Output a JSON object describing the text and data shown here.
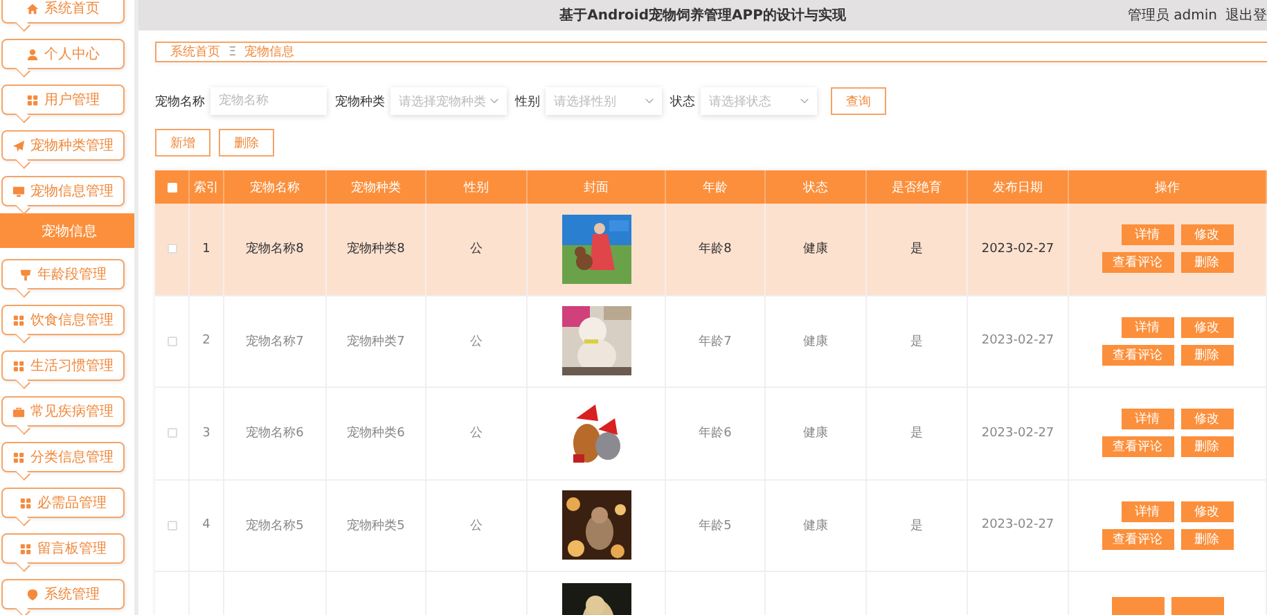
{
  "header": {
    "title": "基于Android宠物饲养管理APP的设计与实现",
    "user": "管理员 admin",
    "logout": "退出登"
  },
  "sidebar": {
    "items": [
      {
        "label": "系统首页",
        "selected": false
      },
      {
        "label": "个人中心",
        "selected": false
      },
      {
        "label": "用户管理",
        "selected": false
      },
      {
        "label": "宠物种类管理",
        "selected": false
      },
      {
        "label": "宠物信息管理",
        "selected": false,
        "children": [
          {
            "label": "宠物信息",
            "selected": true
          }
        ]
      },
      {
        "label": "年龄段管理",
        "selected": false
      },
      {
        "label": "饮食信息管理",
        "selected": false
      },
      {
        "label": "生活习惯管理",
        "selected": false
      },
      {
        "label": "常见疾病管理",
        "selected": false
      },
      {
        "label": "分类信息管理",
        "selected": false
      },
      {
        "label": "必需品管理",
        "selected": false
      },
      {
        "label": "留言板管理",
        "selected": false
      },
      {
        "label": "系统管理",
        "selected": false
      }
    ]
  },
  "breadcrumb": {
    "items": [
      "系统首页",
      "宠物信息"
    ],
    "separator": "Ξ"
  },
  "search": {
    "fields": [
      {
        "label": "宠物名称",
        "placeholder": "宠物名称",
        "kind": "input"
      },
      {
        "label": "宠物种类",
        "placeholder": "请选择宠物种类",
        "kind": "select"
      },
      {
        "label": "性别",
        "placeholder": "请选择性别",
        "kind": "select"
      },
      {
        "label": "状态",
        "placeholder": "请选择状态",
        "kind": "select"
      }
    ],
    "button": "查询"
  },
  "actions": [
    "新增",
    "删除"
  ],
  "table": {
    "select_all": {
      "checked": false
    },
    "columns": [
      "索引",
      "宠物名称",
      "宠物种类",
      "性别",
      "封面",
      "年龄",
      "状态",
      "是否绝育",
      "发布日期",
      "操作"
    ],
    "rows": [
      {
        "highlighted": true,
        "checked": false,
        "cells": [
          "1",
          "宠物名称8",
          "宠物种类8",
          "公",
          {
            "kind": "picture"
          },
          "年龄8",
          "健康",
          "是",
          "2023-02-27"
        ],
        "buttons": [
          "详情",
          "修改",
          "查看评论",
          "删除"
        ]
      },
      {
        "highlighted": false,
        "checked": false,
        "cells": [
          "2",
          "宠物名称7",
          "宠物种类7",
          "公",
          {
            "kind": "picture"
          },
          "年龄7",
          "健康",
          "是",
          "2023-02-27"
        ],
        "buttons": [
          "详情",
          "修改",
          "查看评论",
          "删除"
        ]
      },
      {
        "highlighted": false,
        "checked": false,
        "cells": [
          "3",
          "宠物名称6",
          "宠物种类6",
          "公",
          {
            "kind": "picture"
          },
          "年龄6",
          "健康",
          "是",
          "2023-02-27"
        ],
        "buttons": [
          "详情",
          "修改",
          "查看评论",
          "删除"
        ]
      },
      {
        "highlighted": false,
        "checked": false,
        "cells": [
          "4",
          "宠物名称5",
          "宠物种类5",
          "公",
          {
            "kind": "picture"
          },
          "年龄5",
          "健康",
          "是",
          "2023-02-27"
        ],
        "buttons": [
          "详情",
          "修改",
          "查看评论",
          "删除"
        ]
      },
      {
        "highlighted": false,
        "cells": [
          "",
          "",
          "",
          "",
          {
            "kind": "picture"
          }
        ]
      }
    ]
  }
}
